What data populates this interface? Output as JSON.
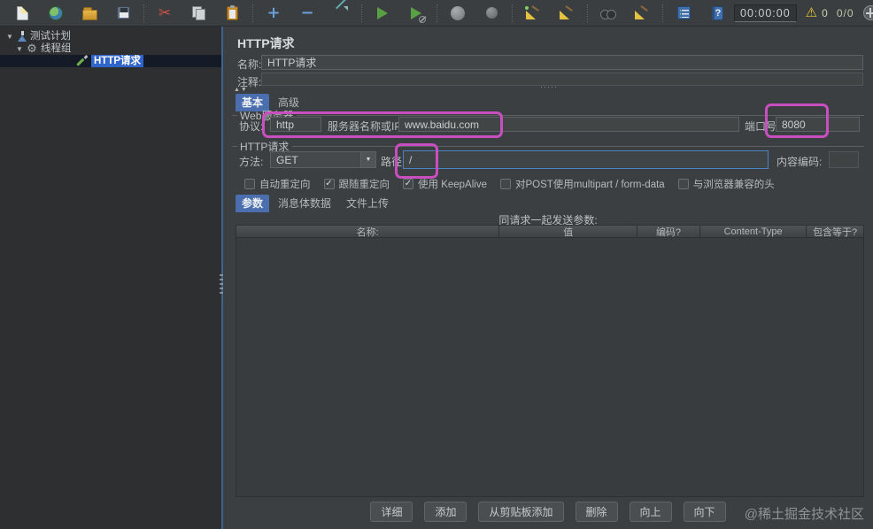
{
  "toolbar": {
    "timer": "00:00:00",
    "warning_count": "0",
    "thread_counter": "0/0",
    "icons": [
      "new-file",
      "templates",
      "open-file",
      "save",
      "cut",
      "copy",
      "paste",
      "expand-all",
      "collapse-all",
      "toggle",
      "start",
      "start-no-pauses",
      "stop",
      "shutdown",
      "clear",
      "clear-all",
      "search",
      "search-reset",
      "function-helper",
      "help",
      "remote-start-all"
    ]
  },
  "glyphs": {
    "cut": "✂",
    "plus": "+",
    "minus": "−",
    "help": "?",
    "warning": "⚠",
    "gear": "⚙",
    "caret_down": "▼",
    "mini_arrows": "▲▼",
    "combo_arrow": "▼",
    "h_grip": "·····"
  },
  "tree": {
    "items": [
      {
        "label": "测试计划",
        "selected": false
      },
      {
        "label": "线程组",
        "selected": false
      },
      {
        "label": "HTTP请求",
        "selected": true
      }
    ]
  },
  "main": {
    "title": "HTTP请求",
    "name_label": "名称:",
    "name_value": "HTTP请求",
    "comment_label": "注释:",
    "comment_value": "",
    "config_tabs": [
      {
        "label": "基本",
        "selected": true
      },
      {
        "label": "高级",
        "selected": false
      }
    ],
    "web_server": {
      "group_title": "Web服务器",
      "protocol_label": "协议:",
      "protocol_value": "http",
      "server_label": "服务器名称或IP:",
      "server_value": "www.baidu.com",
      "port_label": "端口号:",
      "port_value": "8080"
    },
    "http_request": {
      "group_title": "HTTP请求",
      "method_label": "方法:",
      "method_value": "GET",
      "path_label": "路径:",
      "path_value": "/",
      "encoding_label": "内容编码:",
      "encoding_value": ""
    },
    "options": [
      {
        "label": "自动重定向",
        "checked": false
      },
      {
        "label": "跟随重定向",
        "checked": true
      },
      {
        "label": "使用 KeepAlive",
        "checked": true
      },
      {
        "label": "对POST使用multipart / form-data",
        "checked": false
      },
      {
        "label": "与浏览器兼容的头",
        "checked": false
      }
    ],
    "body_tabs": [
      {
        "label": "参数",
        "selected": true
      },
      {
        "label": "消息体数据",
        "selected": false
      },
      {
        "label": "文件上传",
        "selected": false
      }
    ],
    "params_caption": "同请求一起发送参数:",
    "table_headers": [
      "名称:",
      "值",
      "编码?",
      "Content-Type",
      "包含等于?"
    ],
    "buttons": [
      "详细",
      "添加",
      "从剪贴板添加",
      "删除",
      "向上",
      "向下"
    ]
  },
  "annotations": {
    "highlight_color": "#cb4ec1"
  },
  "watermark": "@稀土掘金技术社区"
}
